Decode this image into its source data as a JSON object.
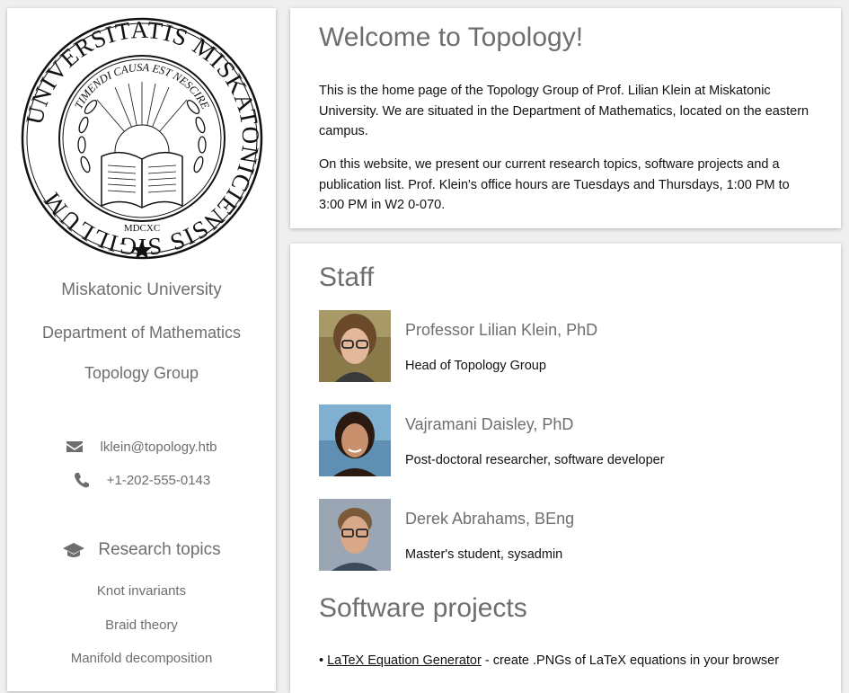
{
  "sidebar": {
    "seal": {
      "outer_text": "UNIVERSITATIS MISKATONICIENSIS SIGILLUM",
      "inner_text": "TIMENDI CAUSA EST NESCIRE",
      "year": "MDCXC"
    },
    "university": "Miskatonic University",
    "department": "Department of Mathematics",
    "group": "Topology Group",
    "contact": {
      "email": "lklein@topology.htb",
      "phone": "+1-202-555-0143"
    },
    "research_heading": "Research topics",
    "topics": [
      "Knot invariants",
      "Braid theory",
      "Manifold decomposition"
    ]
  },
  "welcome": {
    "title": "Welcome to Topology!",
    "paragraph1": "This is the home page of the Topology Group of Prof. Lilian Klein at Miskatonic University. We are situated in the Department of Mathematics, located on the eastern campus.",
    "paragraph2": "On this website, we present our current research topics, software projects and a publication list. Prof. Klein's office hours are Tuesdays and Thursdays, 1:00 PM to 3:00 PM in W2 0-070."
  },
  "staff": {
    "title": "Staff",
    "members": [
      {
        "name": "Professor Lilian Klein, PhD",
        "role": "Head of Topology Group"
      },
      {
        "name": "Vajramani Daisley, PhD",
        "role": "Post-doctoral researcher, software developer"
      },
      {
        "name": "Derek Abrahams, BEng",
        "role": "Master's student, sysadmin"
      }
    ]
  },
  "software": {
    "title": "Software projects",
    "items": [
      {
        "bullet": "•",
        "link": "LaTeX Equation Generator",
        "desc": " - create .PNGs of LaTeX equations in your browser"
      }
    ]
  },
  "colors": {
    "muted_text": "#6e6e6e",
    "background": "#efefef"
  }
}
